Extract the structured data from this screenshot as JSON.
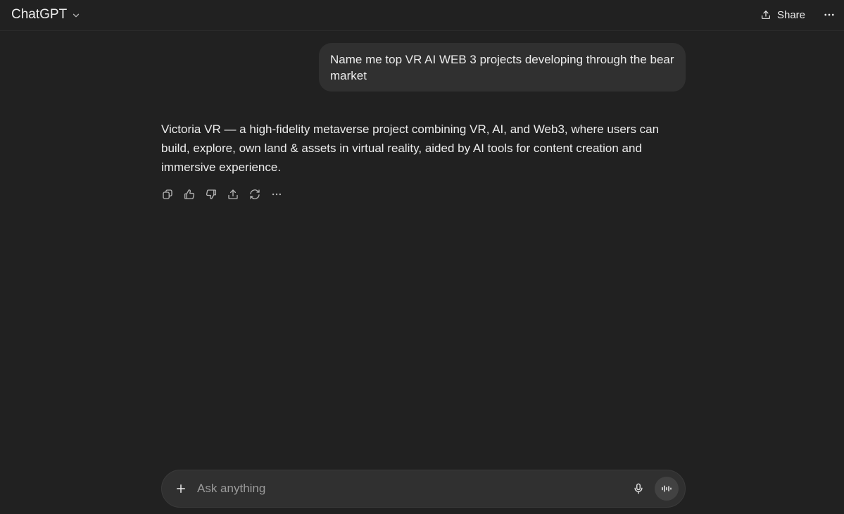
{
  "header": {
    "model_name": "ChatGPT",
    "share_label": "Share"
  },
  "conversation": {
    "user_message": "Name me top VR AI WEB 3 projects developing through the bear market",
    "assistant_message": "Victoria VR — a high-fidelity metaverse project combining VR, AI, and Web3, where users can build, explore, own land & assets in virtual reality, aided by AI tools for content creation and immersive experience."
  },
  "message_actions": [
    "copy-icon",
    "thumbs-up-icon",
    "thumbs-down-icon",
    "share-icon",
    "regenerate-icon",
    "more-icon"
  ],
  "composer": {
    "placeholder": "Ask anything"
  },
  "colors": {
    "background": "#212121",
    "bubble": "#303030",
    "text": "#ececec",
    "placeholder": "#9b9b9b"
  }
}
